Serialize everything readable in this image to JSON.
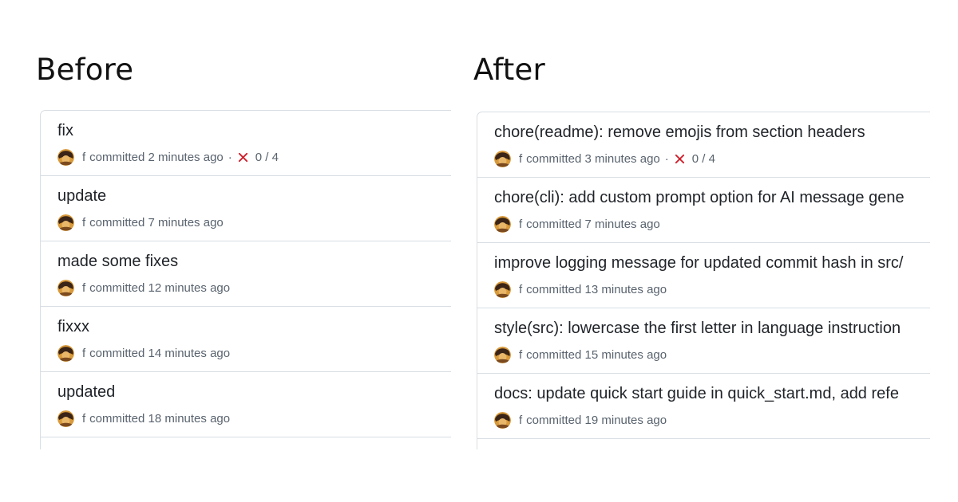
{
  "headings": {
    "before": "Before",
    "after": "After"
  },
  "before": {
    "commits": [
      {
        "title": "fix",
        "author": "f",
        "time": "committed 2 minutes ago",
        "status": "fail",
        "checks": "0 / 4"
      },
      {
        "title": "update",
        "author": "f",
        "time": "committed 7 minutes ago"
      },
      {
        "title": "made some fixes",
        "author": "f",
        "time": "committed 12 minutes ago"
      },
      {
        "title": "fixxx",
        "author": "f",
        "time": "committed 14 minutes ago"
      },
      {
        "title": "updated",
        "author": "f",
        "time": "committed 18 minutes ago"
      }
    ]
  },
  "after": {
    "commits": [
      {
        "title": "chore(readme): remove emojis from section headers",
        "author": "f",
        "time": "committed 3 minutes ago",
        "status": "fail",
        "checks": "0 / 4"
      },
      {
        "title": "chore(cli): add custom prompt option for AI message gene",
        "author": "f",
        "time": "committed 7 minutes ago"
      },
      {
        "title": "improve logging message for updated commit hash in src/",
        "author": "f",
        "time": "committed 13 minutes ago"
      },
      {
        "title": "style(src): lowercase the first letter in language instruction",
        "author": "f",
        "time": "committed 15 minutes ago"
      },
      {
        "title": "docs: update quick start guide in quick_start.md, add refe",
        "author": "f",
        "time": "committed 19 minutes ago"
      }
    ]
  },
  "icons": {
    "avatar": "avatar-icon",
    "fail": "x-icon"
  },
  "colors": {
    "fail": "#cf222e",
    "border": "#d8dee4",
    "meta_text": "#59636e",
    "title_text": "#1f2328"
  }
}
